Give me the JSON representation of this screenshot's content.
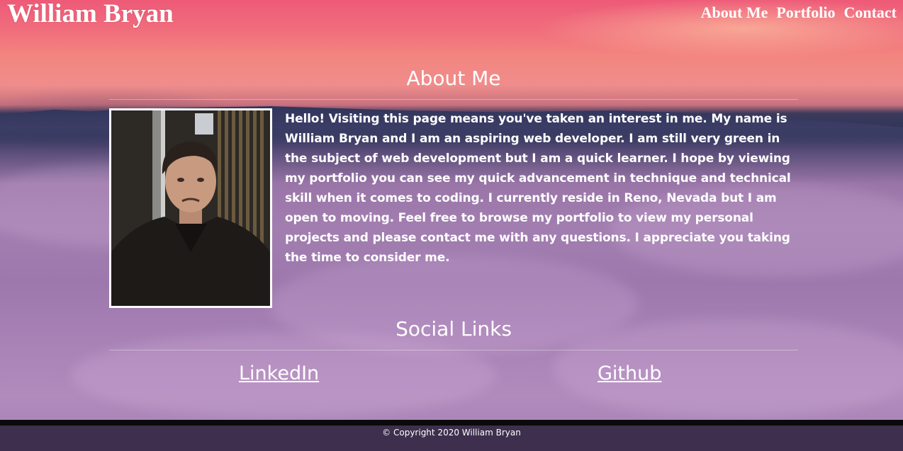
{
  "header": {
    "brand": "William Bryan",
    "nav": [
      "About Me",
      "Portfolio",
      "Contact"
    ]
  },
  "about": {
    "title": "About Me",
    "photo_alt": "portrait photo",
    "text": "Hello! Visiting this page means you've taken an interest in me. My name is William Bryan and I am an aspiring web developer. I am still very green in the subject of web development but I am a quick learner. I hope by viewing my portfolio you can see my quick advancement in technique and technical skill when it comes to coding. I currently reside in Reno, Nevada but I am open to moving. Feel free to browse my portfolio to view my personal projects and please contact me with any questions. I appreciate you taking the time to consider me."
  },
  "social": {
    "title": "Social Links",
    "links": [
      "LinkedIn",
      "Github"
    ]
  },
  "footer": {
    "copyright": "© Copyright 2020 William Bryan"
  },
  "colors": {
    "footer_bg": "#3d2f4d",
    "text": "#ffffff"
  }
}
